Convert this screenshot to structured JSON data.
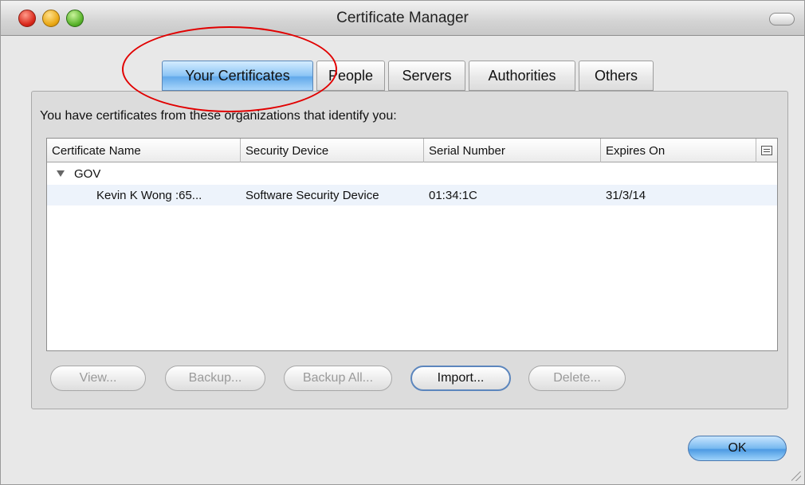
{
  "window": {
    "title": "Certificate Manager"
  },
  "tabs": [
    {
      "label": "Your Certificates",
      "active": true
    },
    {
      "label": "People",
      "active": false
    },
    {
      "label": "Servers",
      "active": false
    },
    {
      "label": "Authorities",
      "active": false
    },
    {
      "label": "Others",
      "active": false
    }
  ],
  "panel": {
    "intro": "You have certificates from these organizations that identify you:"
  },
  "table": {
    "columns": [
      "Certificate Name",
      "Security Device",
      "Serial Number",
      "Expires On"
    ],
    "column_picker_icon": "column-picker-icon",
    "group": {
      "name": "GOV",
      "expanded": true
    },
    "rows": [
      {
        "name": "Kevin K Wong :65...",
        "device": "Software Security Device",
        "serial": "01:34:1C",
        "expires": "31/3/14"
      }
    ]
  },
  "buttons": {
    "view": "View...",
    "backup": "Backup...",
    "backup_all": "Backup All...",
    "import": "Import...",
    "delete": "Delete...",
    "ok": "OK"
  },
  "colors": {
    "annotation": "#e10000",
    "active_tab": "#8cc5f5",
    "selected_row": "#edf3fb"
  }
}
